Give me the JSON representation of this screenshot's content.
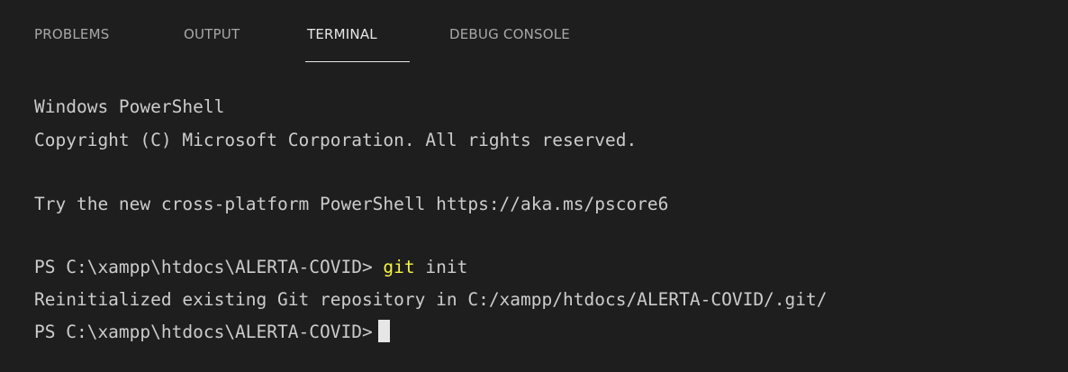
{
  "tabs": [
    {
      "label": "PROBLEMS",
      "active": false
    },
    {
      "label": "OUTPUT",
      "active": false
    },
    {
      "label": "TERMINAL",
      "active": true
    },
    {
      "label": "DEBUG CONSOLE",
      "active": false
    }
  ],
  "terminal": {
    "banner_line1": "Windows PowerShell",
    "banner_line2": "Copyright (C) Microsoft Corporation. All rights reserved.",
    "banner_line3": "Try the new cross-platform PowerShell https://aka.ms/pscore6",
    "prompt": "PS C:\\xampp\\htdocs\\ALERTA-COVID> ",
    "command_keyword": "git",
    "command_args": " init",
    "output_line": "Reinitialized existing Git repository in C:/xampp/htdocs/ALERTA-COVID/.git/",
    "prompt2": "PS C:\\xampp\\htdocs\\ALERTA-COVID>"
  },
  "colors": {
    "background": "#1e1e1e",
    "text": "#cccccc",
    "command_highlight": "#f5f543",
    "tab_active": "#e7e7e7",
    "tab_inactive": "#a8a8a8"
  }
}
